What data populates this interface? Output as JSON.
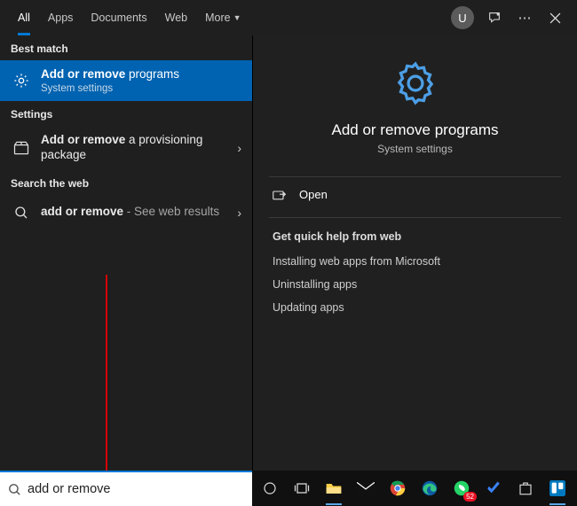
{
  "tabs": {
    "all": "All",
    "apps": "Apps",
    "documents": "Documents",
    "web": "Web",
    "more": "More"
  },
  "titlebar": {
    "avatar_initial": "U"
  },
  "left": {
    "best_match_label": "Best match",
    "best_match": {
      "title_bold": "Add or remove",
      "title_rest": " programs",
      "subtitle": "System settings"
    },
    "settings_label": "Settings",
    "settings_item": {
      "title_bold": "Add or remove",
      "title_rest": " a provisioning package"
    },
    "web_label": "Search the web",
    "web_item": {
      "title_bold": "add or remove",
      "suffix": " - See web results"
    }
  },
  "detail": {
    "title": "Add or remove programs",
    "subtitle": "System settings",
    "open_label": "Open",
    "help_label": "Get quick help from web",
    "help_links": [
      "Installing web apps from Microsoft",
      "Uninstalling apps",
      "Updating apps"
    ]
  },
  "search": {
    "value": "add or remove"
  }
}
